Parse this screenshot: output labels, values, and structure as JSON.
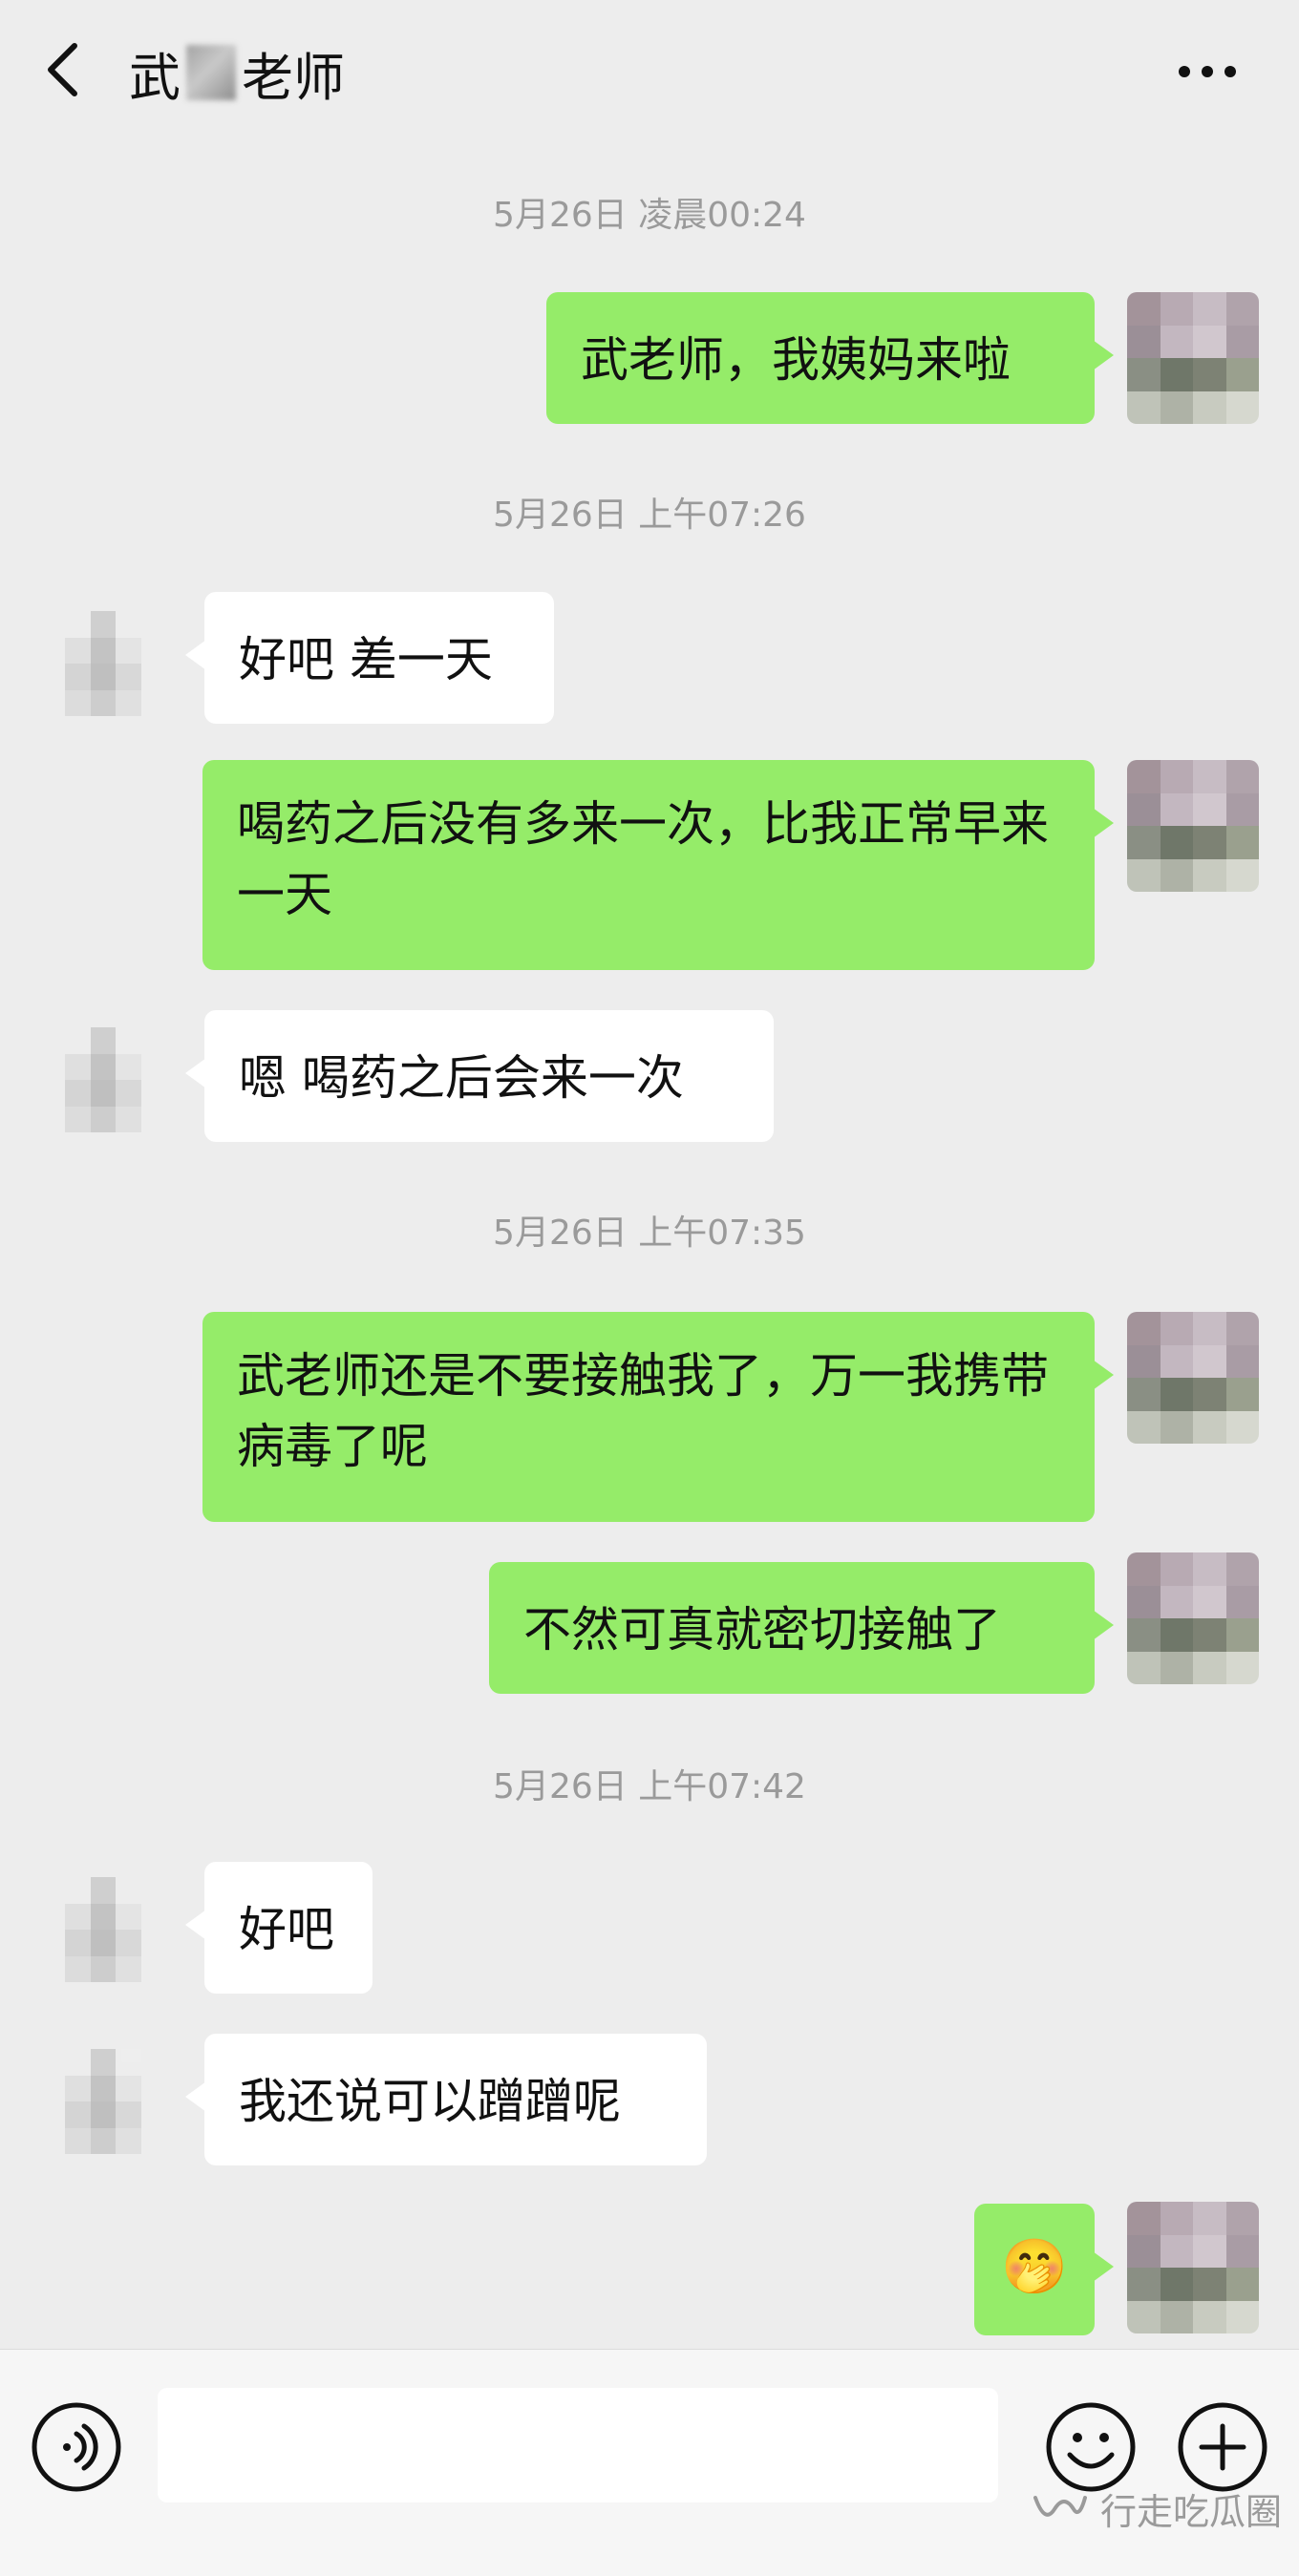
{
  "header": {
    "title_prefix": "武",
    "title_suffix": "老师",
    "back_icon": "chevron-left-icon",
    "more_icon": "more-dots-icon"
  },
  "messages": [
    {
      "type": "time",
      "text": "5月26日 凌晨00:24"
    },
    {
      "type": "msg",
      "side": "right",
      "text": "武老师，我姨妈来啦"
    },
    {
      "type": "time",
      "text": "5月26日 上午07:26"
    },
    {
      "type": "msg",
      "side": "left",
      "text": "好吧 差一天"
    },
    {
      "type": "msg",
      "side": "right",
      "text": "喝药之后没有多来一次，比我正常早来一天"
    },
    {
      "type": "msg",
      "side": "left",
      "text": "嗯 喝药之后会来一次"
    },
    {
      "type": "time",
      "text": "5月26日 上午07:35"
    },
    {
      "type": "msg",
      "side": "right",
      "text": "武老师还是不要接触我了，万一我携带病毒了呢"
    },
    {
      "type": "msg",
      "side": "right",
      "text": "不然可真就密切接触了"
    },
    {
      "type": "time",
      "text": "5月26日 上午07:42"
    },
    {
      "type": "msg",
      "side": "left",
      "text": "好吧"
    },
    {
      "type": "msg",
      "side": "left",
      "text": "我还说可以蹭蹭呢"
    },
    {
      "type": "msg",
      "side": "right",
      "text": "🤭",
      "emoji": true
    }
  ],
  "input_bar": {
    "voice_icon": "voice-icon",
    "emoji_icon": "emoji-smile-icon",
    "plus_icon": "plus-circle-icon",
    "input_value": ""
  },
  "watermark": {
    "text": "行走吃瓜圈",
    "icon": "wechat-channel-icon"
  },
  "colors": {
    "background": "#ededed",
    "self_bubble": "#95ec69",
    "other_bubble": "#ffffff",
    "timestamp": "#9a9a9a"
  }
}
